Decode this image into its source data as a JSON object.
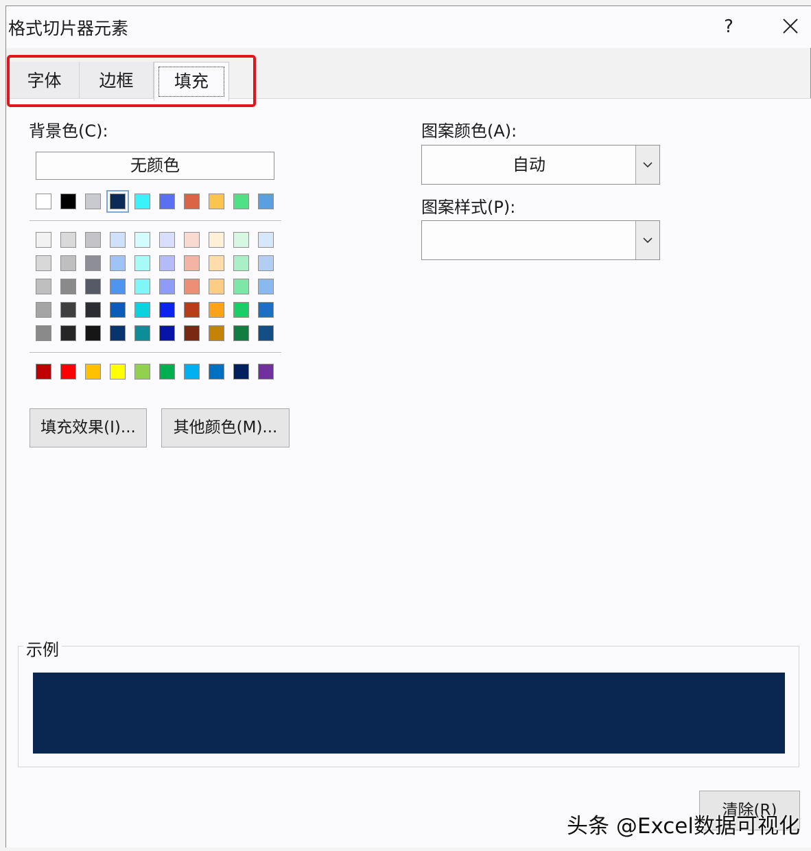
{
  "window": {
    "title": "格式切片器元素",
    "help_label": "?",
    "close_icon": "close-icon"
  },
  "tabs": [
    {
      "label": "字体",
      "selected": false
    },
    {
      "label": "边框",
      "selected": false
    },
    {
      "label": "填充",
      "selected": true
    }
  ],
  "background": {
    "label": "背景色(C):",
    "no_color_label": "无颜色",
    "theme_top": [
      "#ffffff",
      "#000000",
      "#c9c9d0",
      "#0b2a55",
      "#3af2f7",
      "#5a6ff2",
      "#dc6446",
      "#fbc44f",
      "#4ee186",
      "#5c9fe0"
    ],
    "theme_tints": [
      [
        "#f2f2f2",
        "#d9d9d9",
        "#c3c3c8",
        "#cfe0fa",
        "#d4fcfd",
        "#d8defc",
        "#f9d9d0",
        "#fef0d6",
        "#d6f8e3",
        "#d6e7fa"
      ],
      [
        "#d8d8d8",
        "#bfbfbf",
        "#8d8e98",
        "#9ec3f4",
        "#a8faf9",
        "#b3bcf9",
        "#f3b4a3",
        "#feddab",
        "#a9f0c6",
        "#b2cff3"
      ],
      [
        "#bfbfbf",
        "#8a8a8a",
        "#565966",
        "#4f95f0",
        "#7ff7f9",
        "#8e9cf7",
        "#ec8f76",
        "#fdcd85",
        "#7de7a8",
        "#8ab9ef"
      ],
      [
        "#a5a5a5",
        "#3f3f3f",
        "#2b2d33",
        "#0d5bb9",
        "#0bd2dc",
        "#0a23ef",
        "#b93c1a",
        "#fca21b",
        "#1bcc67",
        "#1c6fc3"
      ],
      [
        "#8a8a8a",
        "#262626",
        "#161616",
        "#08336f",
        "#0d8e96",
        "#0615a7",
        "#7b2812",
        "#c48207",
        "#117d42",
        "#134e87"
      ]
    ],
    "standard": [
      "#c00000",
      "#ff0000",
      "#ffc000",
      "#ffff00",
      "#92d050",
      "#00b050",
      "#00b0f0",
      "#0070c0",
      "#002060",
      "#7030a0"
    ],
    "selected_color": "#0b2a55"
  },
  "buttons": {
    "fill_effects": "填充效果(I)...",
    "more_colors": "其他颜色(M)...",
    "clear": "清除(R)"
  },
  "pattern": {
    "color_label": "图案颜色(A):",
    "color_value": "自动",
    "style_label": "图案样式(P):",
    "style_value": ""
  },
  "sample": {
    "label": "示例",
    "fill_color": "#0a2751"
  },
  "watermark": "头条 @Excel数据可视化"
}
